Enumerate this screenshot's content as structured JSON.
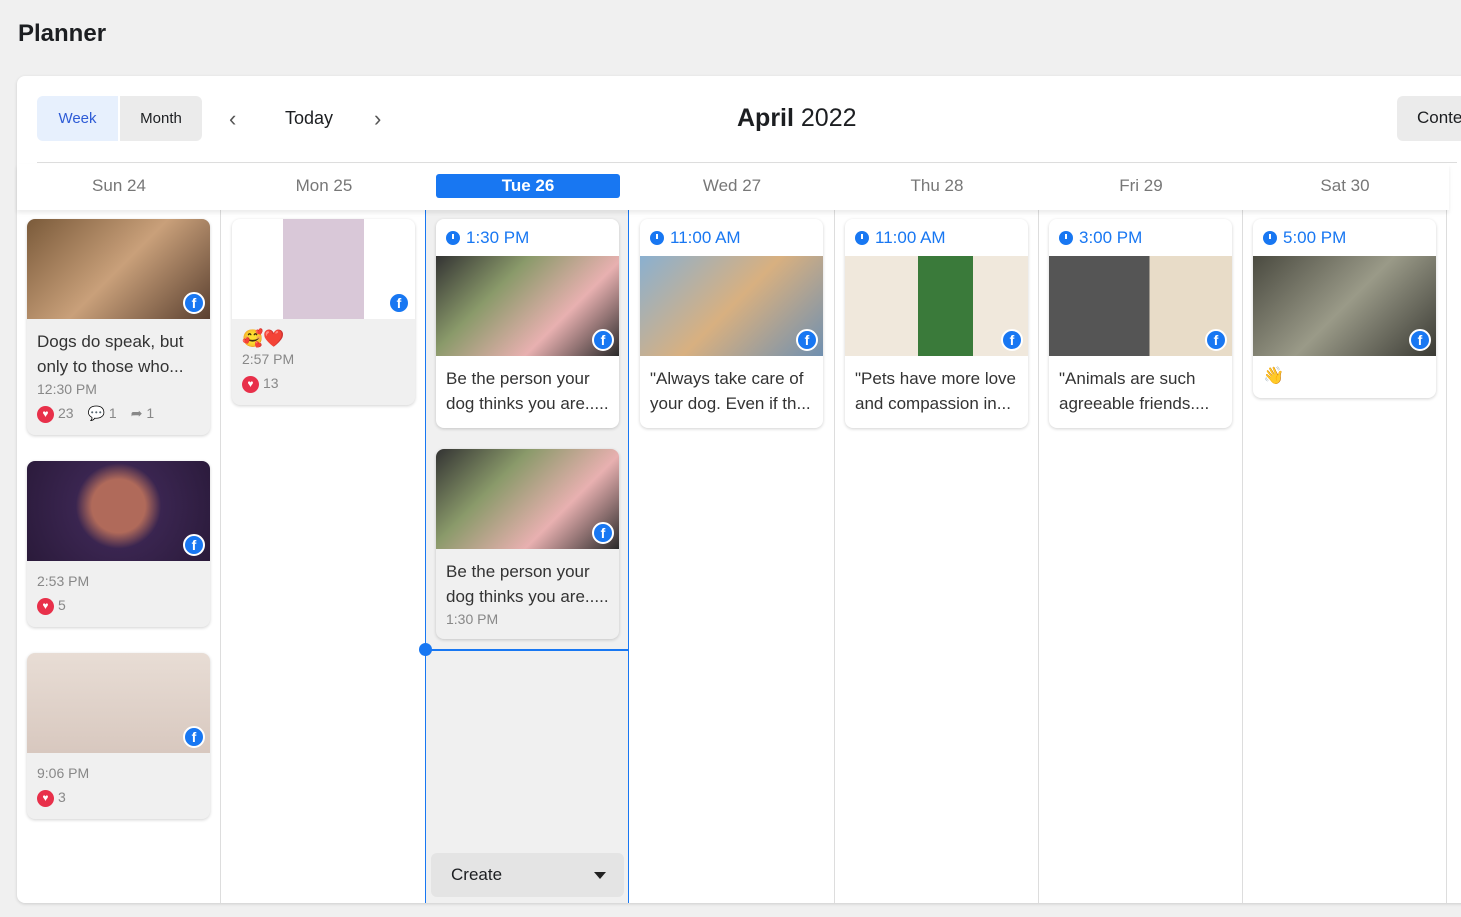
{
  "page_title": "Planner",
  "toolbar": {
    "week": "Week",
    "month": "Month",
    "today": "Today",
    "month_name": "April",
    "year": "2022",
    "content": "Content"
  },
  "days": [
    "Sun 24",
    "Mon 25",
    "Tue 26",
    "Wed 27",
    "Thu 28",
    "Fri 29",
    "Sat 30"
  ],
  "posts": {
    "sun1": {
      "text": "Dogs do speak, but only to those who...",
      "time": "12:30 PM",
      "likes": "23",
      "comments": "1",
      "shares": "1"
    },
    "sun2": {
      "time": "2:53 PM",
      "reactions": "5"
    },
    "sun3": {
      "time": "9:06 PM",
      "likes": "3"
    },
    "mon1": {
      "emoji": "🥰❤️",
      "time": "2:57 PM",
      "likes": "13"
    },
    "tue1": {
      "scheduled": "1:30 PM",
      "text": "Be the person your dog thinks you are....."
    },
    "tue2": {
      "text": "Be the person your dog thinks you are.....",
      "time": "1:30 PM"
    },
    "wed1": {
      "scheduled": "11:00 AM",
      "text": "\"Always take care of your dog. Even if th..."
    },
    "thu1": {
      "scheduled": "11:00 AM",
      "text": "\"Pets have more love and compassion in..."
    },
    "fri1": {
      "scheduled": "3:00 PM",
      "text": "\"Animals are such agreeable friends...."
    },
    "sat1": {
      "scheduled": "5:00 PM",
      "emoji": "👋"
    }
  },
  "create_label": "Create",
  "colors": {
    "accent": "#1877f2",
    "heart": "#e8304a"
  }
}
